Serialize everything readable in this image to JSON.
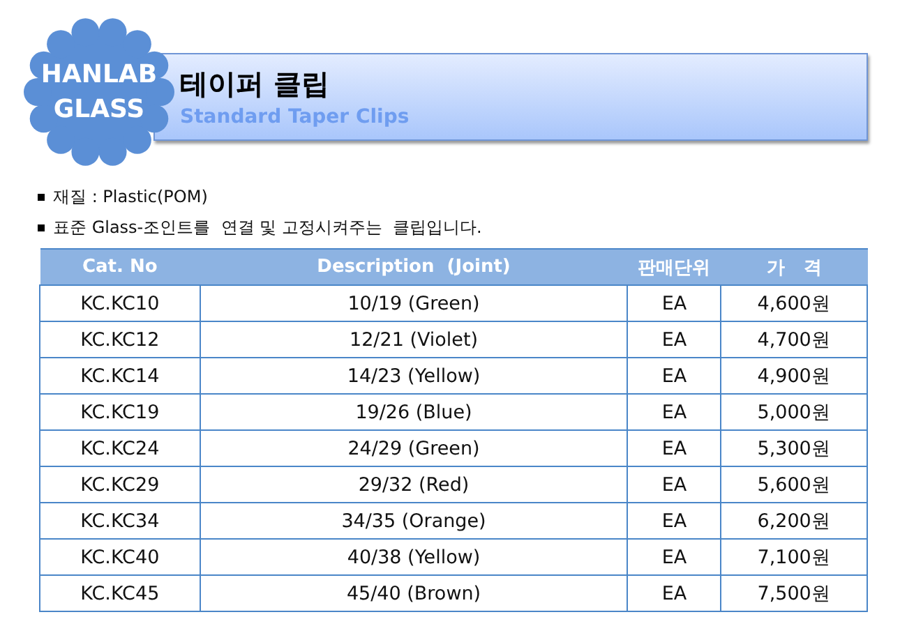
{
  "logo": {
    "lines": [
      "HANLAB",
      "GLASS"
    ]
  },
  "header": {
    "title": "테이퍼 클립",
    "subtitle": "Standard Taper Clips"
  },
  "notes": [
    "재질 : Plastic(POM)",
    "표준 Glass-조인트를  연결 및 고정시켜주는  클립입니다."
  ],
  "table": {
    "columns": [
      "Cat. No",
      "Description  (Joint)",
      "판매단위",
      "가   격"
    ],
    "rows": [
      [
        "KC.KC10",
        "10/19 (Green)",
        "EA",
        "4,600원"
      ],
      [
        "KC.KC12",
        "12/21 (Violet)",
        "EA",
        "4,700원"
      ],
      [
        "KC.KC14",
        "14/23 (Yellow)",
        "EA",
        "4,900원"
      ],
      [
        "KC.KC19",
        "19/26 (Blue)",
        "EA",
        "5,000원"
      ],
      [
        "KC.KC24",
        "24/29 (Green)",
        "EA",
        "5,300원"
      ],
      [
        "KC.KC29",
        "29/32 (Red)",
        "EA",
        "5,600원"
      ],
      [
        "KC.KC34",
        "34/35 (Orange)",
        "EA",
        "6,200원"
      ],
      [
        "KC.KC40",
        "40/38 (Yellow)",
        "EA",
        "7,100원"
      ],
      [
        "KC.KC45",
        "45/40 (Brown)",
        "EA",
        "7,500원"
      ]
    ]
  }
}
